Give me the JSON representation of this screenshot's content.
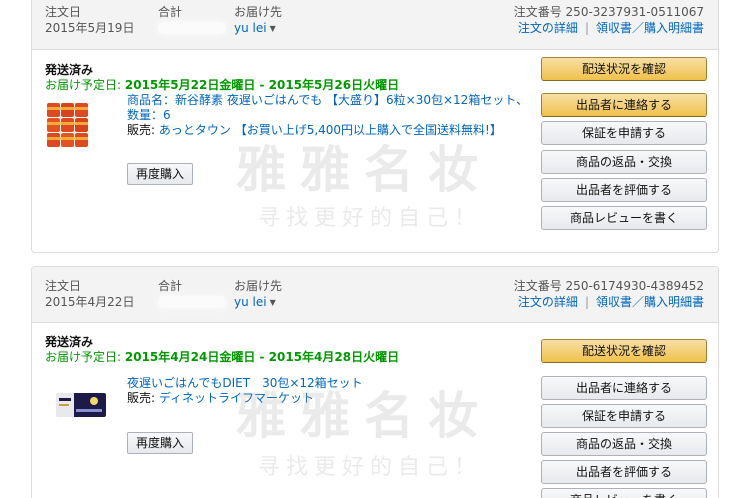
{
  "orders": [
    {
      "date_label": "注文日",
      "date": "2015年5月19日",
      "total_label": "合計",
      "ship_to_label": "お届け先",
      "ship_to": "yu lei",
      "order_no_label": "注文番号",
      "order_no": "250-3237931-0511067",
      "details_link": "注文の詳細",
      "separator": "|",
      "receipt_link": "領収書／購入明細書",
      "status": "発送済み",
      "delivery_label": "お届け予定日:",
      "delivery_dates": "2015年5月22日金曜日 - 2015年5月26日火曜日",
      "product_name": "商品名：新谷酵素 夜遅いごはんでも 【大盛り】6粒×30包×12箱セット、",
      "quantity": "数量：6",
      "seller_label": "販売:",
      "seller": "あっとタウン 【お買い上げ5,400円以上購入で全国送料無料!】",
      "rebuy_label": "再度購入",
      "buttons": [
        "配送状況を確認",
        "出品者に連絡する",
        "保証を申請する",
        "商品の返品・交換",
        "出品者を評価する",
        "商品レビューを書く"
      ]
    },
    {
      "date_label": "注文日",
      "date": "2015年4月22日",
      "total_label": "合計",
      "ship_to_label": "お届け先",
      "ship_to": "yu lei",
      "order_no_label": "注文番号",
      "order_no": "250-6174930-4389452",
      "details_link": "注文の詳細",
      "separator": "|",
      "receipt_link": "領収書／購入明細書",
      "status": "発送済み",
      "delivery_label": "お届け予定日:",
      "delivery_dates": "2015年4月24日金曜日 - 2015年4月28日火曜日",
      "product_name": "夜遅いごはんでもDIET　30包×12箱セット",
      "seller_label": "販売:",
      "seller": "ディネットライフマーケット",
      "rebuy_label": "再度購入",
      "buttons": [
        "配送状況を確認",
        "出品者に連絡する",
        "保証を申請する",
        "商品の返品・交換",
        "出品者を評価する",
        "商品レビューを書く"
      ]
    }
  ],
  "watermark": {
    "big": "雅雅名妆",
    "small": "寻找更好的自己！"
  },
  "colors": {
    "link": "#0066c0",
    "delivery_green": "#009900",
    "primary_button": "#f0c14b"
  }
}
